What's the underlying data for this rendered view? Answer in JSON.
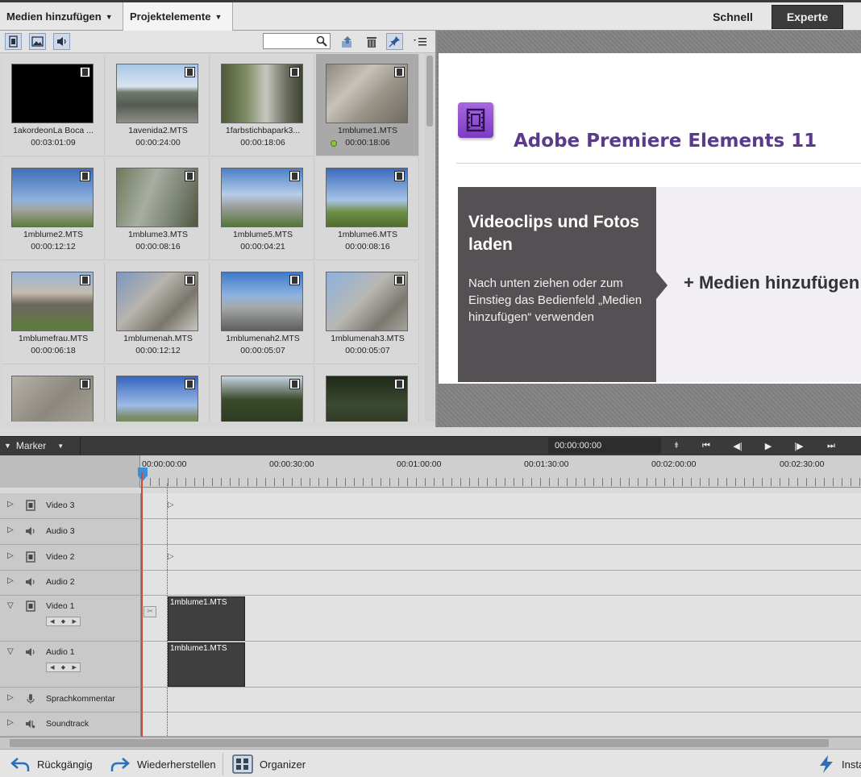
{
  "topbar": {
    "add_media": "Medien hinzufügen",
    "project_assets": "Projektelemente",
    "quick": "Schnell",
    "expert": "Experte"
  },
  "project_panel": {
    "search_value": "",
    "icons": [
      "video-filter-icon",
      "photo-filter-icon",
      "audio-filter-icon",
      "search-icon",
      "export-icon",
      "trash-icon",
      "pin-icon",
      "panel-menu-icon"
    ],
    "items": [
      {
        "name": "1akordeonLa Boca ...",
        "duration": "00:03:01:09",
        "thumb": "linear-gradient(#000,#000)"
      },
      {
        "name": "1avenida2.MTS",
        "duration": "00:00:24:00",
        "thumb": "linear-gradient(#a9c6e6 0%, #d8e4ef 38%, #6f7a6a 48%, #555a52 70%, #8c8f88 100%)"
      },
      {
        "name": "1farbstichbapark3...",
        "duration": "00:00:18:06",
        "thumb": "linear-gradient(90deg, #4f5a3a 0%, #7d8a62 30%, #c6c7bf 55%, #6b6e60 80%, #3c4430 100%)"
      },
      {
        "name": "1mblume1.MTS",
        "duration": "00:00:18:06",
        "thumb": "linear-gradient(135deg, #8d8980 0%, #c7c3ba 35%, #9b958a 60%, #6f6a60 100%)",
        "selected": true,
        "used": true
      },
      {
        "name": "1mblume2.MTS",
        "duration": "00:00:12:12",
        "thumb": "linear-gradient(#3f6fb8 0%, #8fb1dd 55%, #a5a6a0 70%, #5d7b3f 100%)"
      },
      {
        "name": "1mblume3.MTS",
        "duration": "00:00:08:16",
        "thumb": "linear-gradient(110deg, #6e7a5a 0%, #a7aea2 40%, #7d8576 70%, #50573f 100%)"
      },
      {
        "name": "1mblume5.MTS",
        "duration": "00:00:04:21",
        "thumb": "linear-gradient(#4b7fc7 0%, #b7cde8 45%, #9da0a0 65%, #55763a 100%)"
      },
      {
        "name": "1mblume6.MTS",
        "duration": "00:00:08:16",
        "thumb": "linear-gradient(#3a6cc0 0%, #a8c3e6 55%, #6f8f45 75%, #4f6e2f 100%)"
      },
      {
        "name": "1mblumefrau.MTS",
        "duration": "00:00:06:18",
        "thumb": "linear-gradient(#9ab6d8 0%, #c4bcae 35%, #6d685e 55%, #5e7d3c 100%)"
      },
      {
        "name": "1mblumenah.MTS",
        "duration": "00:00:12:12",
        "thumb": "linear-gradient(135deg, #7d96c0 0%, #b7b4ad 40%, #7a766d 70%, #c8c6c0 100%)"
      },
      {
        "name": "1mblumenah2.MTS",
        "duration": "00:00:05:07",
        "thumb": "linear-gradient(#3d79c9 0%, #8fb3e0 40%, #a6a9a6 60%, #5e6060 100%)"
      },
      {
        "name": "1mblumenah3.MTS",
        "duration": "00:00:05:07",
        "thumb": "linear-gradient(135deg, #8cb1e0 0%, #b9b8b2 45%, #7b7870 75%, #a5a39c 100%)"
      },
      {
        "name": "",
        "duration": "",
        "thumb": "linear-gradient(135deg, #b6b2a8 0%, #8d887e 50%, #a9a49a 100%)"
      },
      {
        "name": "",
        "duration": "",
        "thumb": "linear-gradient(#3565c0 0%, #9dbbe5 50%, #7d8d6a 70%, #5a8a3a 100%)"
      },
      {
        "name": "",
        "duration": "",
        "thumb": "linear-gradient(#c7d6e4 0%, #3b4a2a 40%, #2e3a22 80%, #8d3a3a 100%)"
      },
      {
        "name": "",
        "duration": "",
        "thumb": "linear-gradient(#1f2a1a 0%, #3c4a30 50%, #2a3020 100%)"
      }
    ]
  },
  "preview": {
    "app_title": "Adobe Premiere Elements 11",
    "heading": "Videoclips und Fotos laden",
    "body": "Nach unten ziehen oder zum Einstieg das Bedienfeld „Medien hinzufügen“ verwenden",
    "add_media": "+ Medien hinzufügen"
  },
  "timeline": {
    "marker": "Marker",
    "timecode": "00:00:00:00",
    "controls": [
      "⯒",
      "⏮",
      "◀|",
      "▶",
      "|▶",
      "⏭"
    ],
    "ruler_labels": [
      "00:00:00:00",
      "00:00:30:00",
      "00:01:00:00",
      "00:01:30:00",
      "00:02:00:00",
      "00:02:30:00"
    ],
    "tracks": [
      {
        "name": "Video 3",
        "kind": "video"
      },
      {
        "name": "Audio 3",
        "kind": "audio"
      },
      {
        "name": "Video 2",
        "kind": "video"
      },
      {
        "name": "Audio 2",
        "kind": "audio"
      },
      {
        "name": "Video 1",
        "kind": "video",
        "clip": "1mblume1.MTS"
      },
      {
        "name": "Audio 1",
        "kind": "audio",
        "clip": "1mblume1.MTS"
      },
      {
        "name": "Sprachkommentar",
        "kind": "mic"
      },
      {
        "name": "Soundtrack",
        "kind": "music"
      }
    ]
  },
  "bottombar": {
    "undo": "Rückgängig",
    "redo": "Wiederherstellen",
    "organizer": "Organizer",
    "instant": "Insta"
  }
}
